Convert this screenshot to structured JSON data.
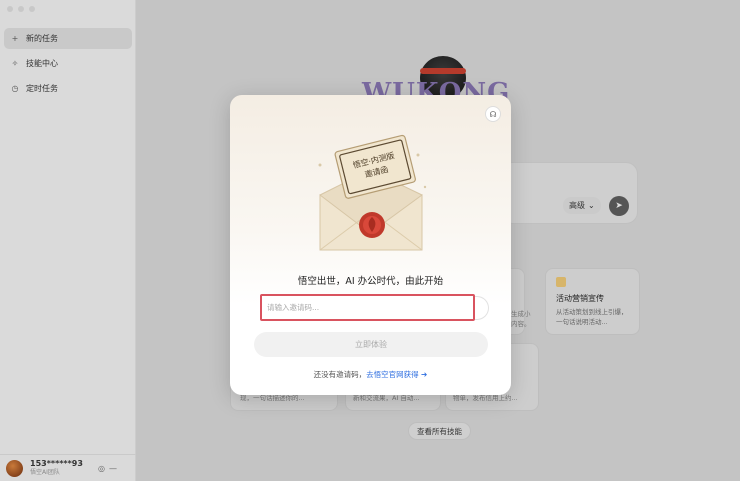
{
  "sidebar": {
    "items": [
      {
        "icon": "plus-icon",
        "glyph": "+",
        "label": "新的任务",
        "active": true
      },
      {
        "icon": "sparkle-icon",
        "glyph": "✧",
        "label": "技能中心",
        "active": false
      },
      {
        "icon": "clock-icon",
        "glyph": "◷",
        "label": "定时任务",
        "active": false
      }
    ],
    "user": {
      "id": "153******93",
      "subtitle": "悟空AI团队",
      "settings_glyph": "◎",
      "more_glyph": "—"
    }
  },
  "main": {
    "logo_text": "WUKONG",
    "model_select": {
      "label": "高级",
      "chevron": "⌄"
    },
    "send_glyph": "➤",
    "skill_card": {
      "title": "活动营销宣传",
      "desc": "从活动策划到线上引爆，一句话说明活动..."
    },
    "partial_card_text": "生成小\n内容。",
    "bg_card_texts": [
      "现，一句话描述你的...",
      "新和交流果，AI 自动...",
      "物单，发布信用上约..."
    ],
    "all_skills_label": "查看所有技能"
  },
  "modal": {
    "envelope_letter_text": "悟空·内测版\n邀请函",
    "headline": "悟空出世，AI 办公时代，由此开始",
    "input_placeholder": "请输入邀请码...",
    "input_value": "",
    "try_button": "立即体验",
    "footer_prefix": "还没有邀请码，",
    "footer_link": "去悟空官网获得 ➔",
    "support_glyph": "☊"
  },
  "colors": {
    "accent_link": "#2f6fe0",
    "input_highlight": "#d9535f",
    "seal_red": "#c0392b"
  }
}
